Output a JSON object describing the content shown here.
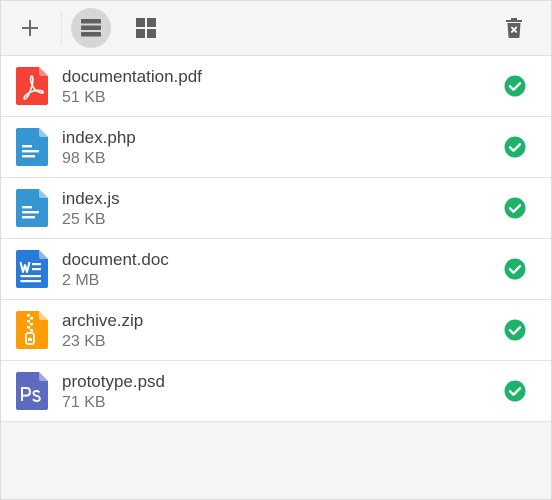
{
  "toolbar": {
    "add_icon": "plus-icon",
    "list_view_icon": "list-view-icon",
    "grid_view_icon": "grid-view-icon",
    "delete_icon": "trash-icon"
  },
  "files": [
    {
      "name": "documentation.pdf",
      "size": "51 KB",
      "type": "pdf",
      "status": "check-circle-icon"
    },
    {
      "name": "index.php",
      "size": "98 KB",
      "type": "code",
      "status": "check-circle-icon"
    },
    {
      "name": "index.js",
      "size": "25 KB",
      "type": "code",
      "status": "check-circle-icon"
    },
    {
      "name": "document.doc",
      "size": "2 MB",
      "type": "word",
      "status": "check-circle-icon"
    },
    {
      "name": "archive.zip",
      "size": "23 KB",
      "type": "zip",
      "status": "check-circle-icon"
    },
    {
      "name": "prototype.psd",
      "size": "71 KB",
      "type": "psd",
      "status": "check-circle-icon"
    }
  ],
  "colors": {
    "success": "#1db36a",
    "pdf": "#f44336",
    "code": "#3596d3",
    "word": "#2a7ad9",
    "zip": "#ff9c08",
    "psd": "#5c6bc0"
  }
}
